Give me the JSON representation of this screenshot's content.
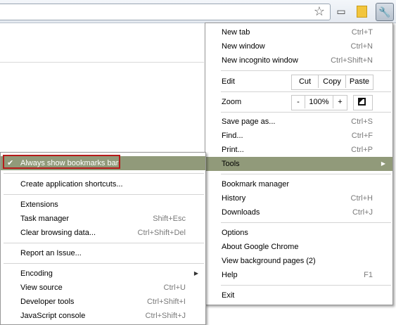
{
  "toolbar": {
    "icons": [
      "star-icon",
      "page-icon",
      "bookmark-icon",
      "wrench-icon"
    ]
  },
  "main_menu": {
    "new_tab": {
      "label": "New tab",
      "shortcut": "Ctrl+T"
    },
    "new_window": {
      "label": "New window",
      "shortcut": "Ctrl+N"
    },
    "new_incognito": {
      "label": "New incognito window",
      "shortcut": "Ctrl+Shift+N"
    },
    "edit": {
      "label": "Edit",
      "cut": "Cut",
      "copy": "Copy",
      "paste": "Paste"
    },
    "zoom": {
      "label": "Zoom",
      "minus": "-",
      "level": "100%",
      "plus": "+"
    },
    "save_page": {
      "label": "Save page as...",
      "shortcut": "Ctrl+S"
    },
    "find": {
      "label": "Find...",
      "shortcut": "Ctrl+F"
    },
    "print": {
      "label": "Print...",
      "shortcut": "Ctrl+P"
    },
    "tools": {
      "label": "Tools",
      "arrow": "▶"
    },
    "bookmark_manager": {
      "label": "Bookmark manager"
    },
    "history": {
      "label": "History",
      "shortcut": "Ctrl+H"
    },
    "downloads": {
      "label": "Downloads",
      "shortcut": "Ctrl+J"
    },
    "options": {
      "label": "Options"
    },
    "about": {
      "label": "About Google Chrome"
    },
    "background_pages": {
      "label": "View background pages (2)"
    },
    "help": {
      "label": "Help",
      "shortcut": "F1"
    },
    "exit": {
      "label": "Exit"
    }
  },
  "tools_menu": {
    "always_show_bookmarks": {
      "label": "Always show bookmarks bar",
      "check": "✔"
    },
    "create_shortcuts": {
      "label": "Create application shortcuts..."
    },
    "extensions": {
      "label": "Extensions"
    },
    "task_manager": {
      "label": "Task manager",
      "shortcut": "Shift+Esc"
    },
    "clear_data": {
      "label": "Clear browsing data...",
      "shortcut": "Ctrl+Shift+Del"
    },
    "report_issue": {
      "label": "Report an Issue..."
    },
    "encoding": {
      "label": "Encoding",
      "arrow": "▶"
    },
    "view_source": {
      "label": "View source",
      "shortcut": "Ctrl+U"
    },
    "developer_tools": {
      "label": "Developer tools",
      "shortcut": "Ctrl+Shift+I"
    },
    "js_console": {
      "label": "JavaScript console",
      "shortcut": "Ctrl+Shift+J"
    }
  },
  "colors": {
    "highlight": "#919a7a",
    "annotation_box": "#b61a1a"
  }
}
